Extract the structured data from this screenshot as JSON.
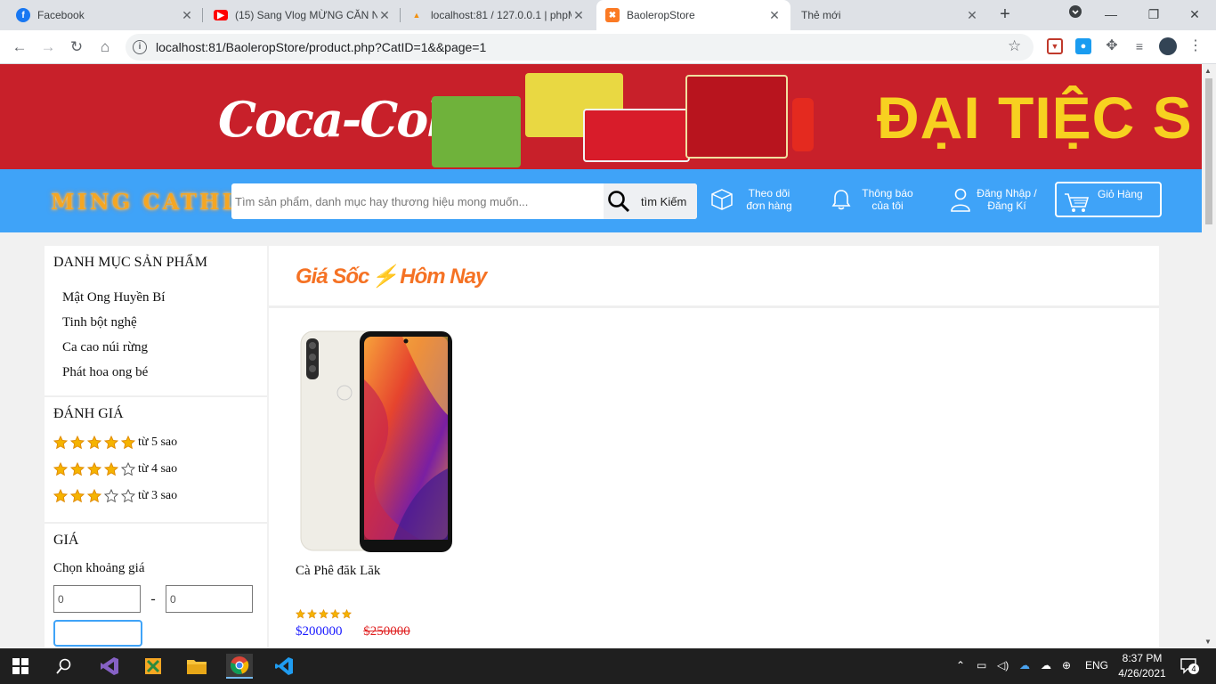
{
  "browser": {
    "tabs": [
      {
        "title": "Facebook",
        "icon": "facebook-icon",
        "color": "#1877f2"
      },
      {
        "title": "(15) Sang Vlog MỪNG CĂN N",
        "icon": "youtube-icon",
        "color": "#ff0000"
      },
      {
        "title": "localhost:81 / 127.0.0.1 | phpM",
        "icon": "phpmyadmin-icon",
        "color": "#f29111"
      },
      {
        "title": "BaoleropStore",
        "icon": "xampp-icon",
        "color": "#fb7a24",
        "active": true
      },
      {
        "title": "Thẻ mới",
        "icon": "",
        "color": ""
      }
    ],
    "new_tab_label": "+",
    "url": "localhost:81/BaoleropStore/product.php?CatID=1&&page=1"
  },
  "banner": {
    "brand": "Coca-Cola",
    "slogan": "ĐẠI TIỆC S"
  },
  "header": {
    "logo": "MING CATHLUS",
    "search_placeholder": "Tìm sản phẩm, danh mục hay thương hiệu mong muốn...",
    "search_button": "tìm Kiếm",
    "track_order": [
      "Theo dõi",
      "đơn hàng"
    ],
    "notifications": [
      "Thông báo",
      "của tôi"
    ],
    "login": [
      "Đăng Nhập /",
      "Đăng Kí"
    ],
    "cart": "Giỏ Hàng"
  },
  "sidebar": {
    "categories_title": "DANH MỤC SẢN PHẨM",
    "categories": [
      "Mật Ong Huyền Bí",
      "Tinh bột nghệ",
      "Ca cao núi rừng",
      "Phát hoa ong bé"
    ],
    "rating_title": "ĐÁNH GIÁ",
    "ratings": [
      {
        "stars": 5,
        "label": "từ 5 sao"
      },
      {
        "stars": 4,
        "label": "từ 4 sao"
      },
      {
        "stars": 3,
        "label": "từ 3 sao"
      }
    ],
    "price_title": "GIÁ",
    "price_label": "Chọn khoảng giá",
    "price_min": "0",
    "price_max": "0",
    "price_separator": "-"
  },
  "main": {
    "title_part1": "Giá Sốc",
    "title_part2": "Hôm Nay",
    "products": [
      {
        "name": "Cà Phê đăk Lăk",
        "rating": 5,
        "price": "$200000",
        "old_price": "$250000"
      }
    ]
  },
  "taskbar": {
    "language": "ENG",
    "time": "8:37 PM",
    "date": "4/26/2021",
    "notification_count": "4"
  },
  "colors": {
    "header_blue": "#3fa3f8",
    "banner_red": "#c8202a",
    "accent_orange": "#f57224",
    "price_blue": "#1a1aff",
    "old_price_red": "#e02020",
    "star_gold": "#f5b301"
  }
}
